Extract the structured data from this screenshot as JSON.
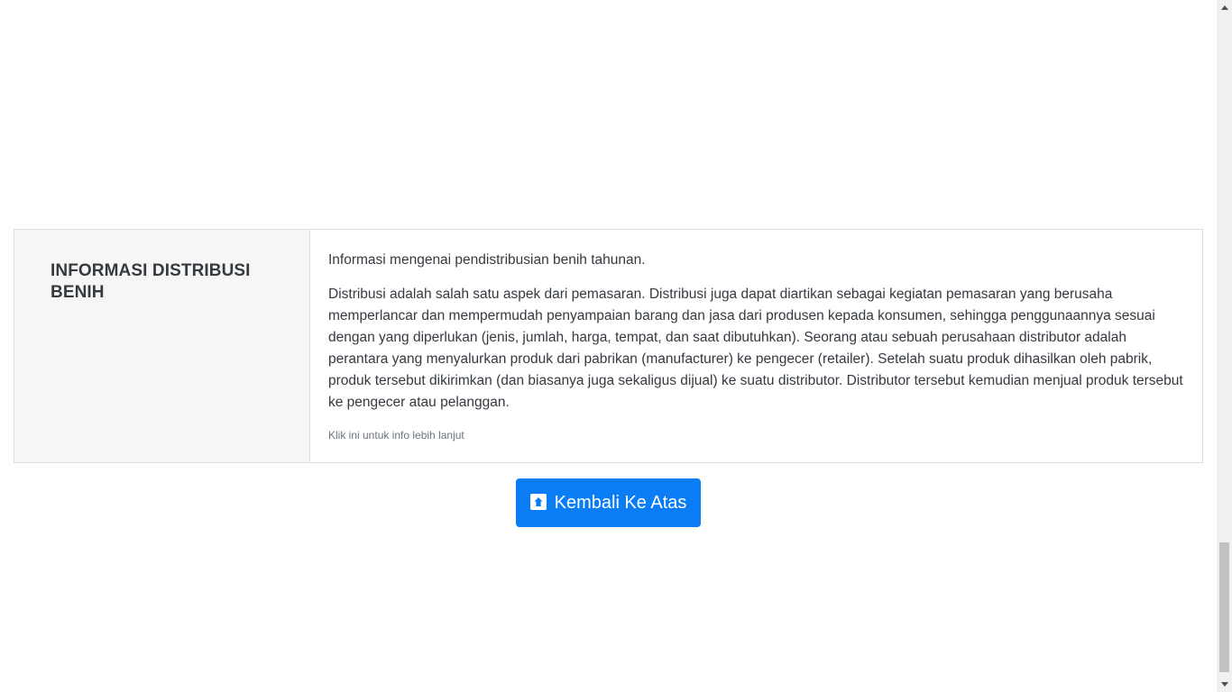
{
  "info": {
    "title": "INFORMASI DISTRIBUSI BENIH",
    "lead": "Informasi mengenai pendistribusian benih tahunan.",
    "description": "Distribusi adalah salah satu aspek dari pemasaran. Distribusi juga dapat diartikan sebagai kegiatan pemasaran yang berusaha memperlancar dan mempermudah penyampaian barang dan jasa dari produsen kepada konsumen, sehingga penggunaannya sesuai dengan yang diperlukan (jenis, jumlah, harga, tempat, dan saat dibutuhkan). Seorang atau sebuah perusahaan distributor adalah perantara yang menyalurkan produk dari pabrikan (manufacturer) ke pengecer (retailer). Setelah suatu produk dihasilkan oleh pabrik, produk tersebut dikirimkan (dan biasanya juga sekaligus dijual) ke suatu distributor. Distributor tersebut kemudian menjual produk tersebut ke pengecer atau pelanggan.",
    "more_link": "Klik ini untuk info lebih lanjut"
  },
  "back_to_top": {
    "label": "Kembali Ke Atas",
    "icon": "arrow-up-square-icon"
  },
  "colors": {
    "button": "#0a7cf4",
    "side_panel": "#f6f6f6"
  }
}
